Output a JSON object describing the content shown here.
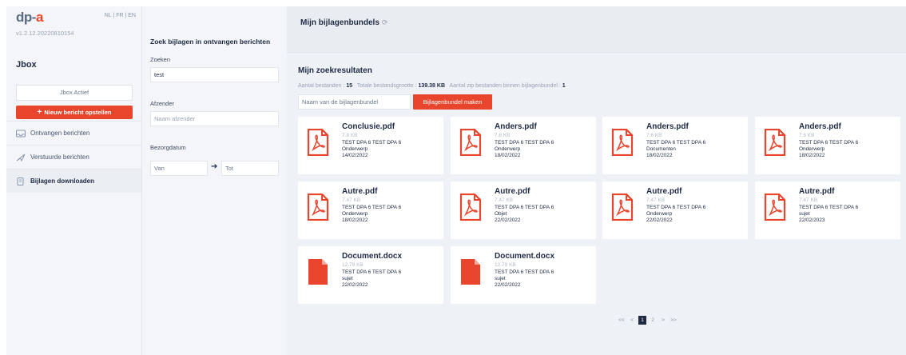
{
  "app": {
    "logo_main": "dp-",
    "logo_accent": "a",
    "langs": [
      "NL",
      "FR",
      "EN"
    ],
    "version": "v1.2.12.20220810154"
  },
  "sidebar": {
    "title": "Jbox",
    "jbox_actief": "Jbox Actief",
    "new_message": "Nieuw bericht opstellen",
    "items": [
      {
        "label": "Ontvangen berichten",
        "icon": "inbox-icon"
      },
      {
        "label": "Verstuurde berichten",
        "icon": "send-icon"
      },
      {
        "label": "Bijlagen downloaden",
        "icon": "attachment-icon"
      }
    ]
  },
  "filters": {
    "title": "Zoek bijlagen in ontvangen berichten",
    "search_label": "Zoeken",
    "search_value": "test",
    "sender_label": "Afzender",
    "sender_placeholder": "Naam afzender",
    "date_label": "Bezorgdatum",
    "date_from": "Van",
    "date_to": "Tot"
  },
  "main": {
    "bundels_title": "Mijn bijlagenbundels",
    "results_title": "Mijn zoekresultaten",
    "stats": {
      "files_label": "Aantal bestanden :",
      "files_value": "15",
      "size_label": "Totale bestandsgrootte :",
      "size_value": "139.38 KB",
      "zip_label": "Aantal zip bestanden binnen bijlagenbundel :",
      "zip_value": "1"
    },
    "bundle_placeholder": "Naam van de bijlagenbundel",
    "bundle_button": "Bijlagenbundel maken"
  },
  "files": [
    {
      "name": "Conclusie.pdf",
      "size": "7.8 KB",
      "from": "TEST DPA 6 TEST DPA 6",
      "subject": "Onderwerp",
      "date": "14/02/2022",
      "type": "pdf"
    },
    {
      "name": "Anders.pdf",
      "size": "7.6 KB",
      "from": "TEST DPA 6 TEST DPA 6",
      "subject": "Onderwerp",
      "date": "18/02/2022",
      "type": "pdf"
    },
    {
      "name": "Anders.pdf",
      "size": "7.6 KB",
      "from": "TEST DPA 6 TEST DPA 6",
      "subject": "Documenten",
      "date": "18/02/2022",
      "type": "pdf"
    },
    {
      "name": "Anders.pdf",
      "size": "7.6 KB",
      "from": "TEST DPA 6 TEST DPA 6",
      "subject": "Onderwerp",
      "date": "18/02/2022",
      "type": "pdf"
    },
    {
      "name": "Autre.pdf",
      "size": "7.47 KB",
      "from": "TEST DPA 6 TEST DPA 6",
      "subject": "Onderwerp",
      "date": "18/02/2022",
      "type": "pdf"
    },
    {
      "name": "Autre.pdf",
      "size": "7.47 KB",
      "from": "TEST DPA 6 TEST DPA 6",
      "subject": "Objet",
      "date": "22/02/2022",
      "type": "pdf"
    },
    {
      "name": "Autre.pdf",
      "size": "7.47 KB",
      "from": "TEST DPA 6 TEST DPA 6",
      "subject": "Onderwerp",
      "date": "22/02/2022",
      "type": "pdf"
    },
    {
      "name": "Autre.pdf",
      "size": "7.47 KB",
      "from": "TEST DPA 6 TEST DPA 6",
      "subject": "sujet",
      "date": "22/02/2023",
      "type": "pdf"
    },
    {
      "name": "Document.docx",
      "size": "12.79 KB",
      "from": "TEST DPA 6 TEST DPA 6",
      "subject": "sujet",
      "date": "22/02/2022",
      "type": "doc"
    },
    {
      "name": "Document.docx",
      "size": "12.79 KB",
      "from": "TEST DPA 6 TEST DPA 6",
      "subject": "sujet",
      "date": "22/02/2022",
      "type": "doc"
    }
  ],
  "pagination": {
    "first": "<<",
    "prev": "<",
    "pages": [
      "1",
      "2"
    ],
    "current": "1",
    "next": ">",
    "last": ">>"
  },
  "colors": {
    "accent": "#e8452c",
    "navy": "#1f2a44"
  }
}
